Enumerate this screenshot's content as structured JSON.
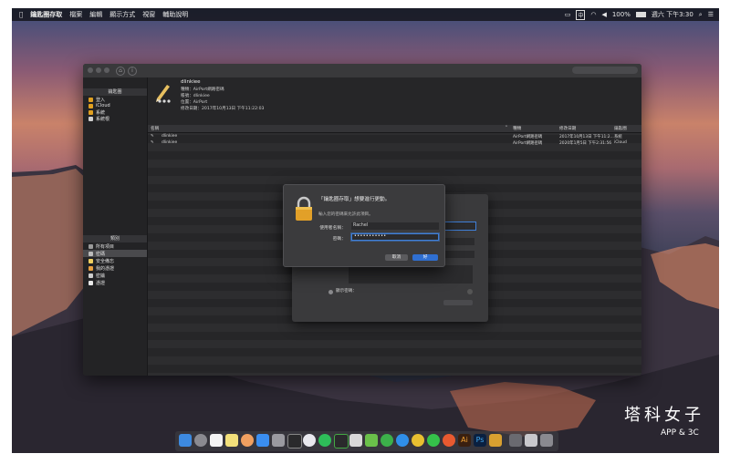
{
  "menubar": {
    "app": "鑰匙圈存取",
    "items": [
      "檔案",
      "編輯",
      "顯示方式",
      "視窗",
      "輔助說明"
    ],
    "battery": "100%",
    "clock": "週六 下午3:30"
  },
  "window": {
    "sidebar": {
      "keychains_header": "鑰匙圈",
      "keychains": [
        "登入",
        "iCloud",
        "系統",
        "系統根"
      ],
      "category_header": "類別",
      "categories": [
        "所有項目",
        "密碼",
        "安全備忘",
        "我的憑證",
        "密鑰",
        "憑證"
      ]
    },
    "info": {
      "name": "dlinkiee",
      "kind": "種類：AirPort網路密碼",
      "account": "帳號：dlinkiee",
      "where": "位置：AirPort",
      "modified": "修改日期：2017年10月13日 下午11:22:03"
    },
    "table": {
      "headers": [
        "名稱",
        "種類",
        "修改日期",
        "鑰匙圈"
      ],
      "rows": [
        [
          "dlinkiee",
          "AirPort網路密碼",
          "2017年10月13日 下午11:2...",
          "系統"
        ],
        [
          "dlinkiee",
          "AirPort網路密碼",
          "2020年1月5日 下午2:31:56",
          "iCloud"
        ]
      ]
    },
    "background_dialog": {
      "show_password": "顯示密碼："
    }
  },
  "auth_dialog": {
    "title": "「鑰匙圈存取」想要進行更動。",
    "subtitle": "輸入您的密碼來允許此項目。",
    "username_label": "使用者名稱：",
    "username_value": "Rachel",
    "password_label": "密碼：",
    "password_value": "•••••••••••",
    "cancel_label": "取消",
    "ok_label": "好"
  },
  "watermark": {
    "line1": "塔科女子",
    "line2": "APP & 3C"
  },
  "colors": {
    "accent": "#2f6fd1",
    "window_bg": "#2a2a2c"
  }
}
